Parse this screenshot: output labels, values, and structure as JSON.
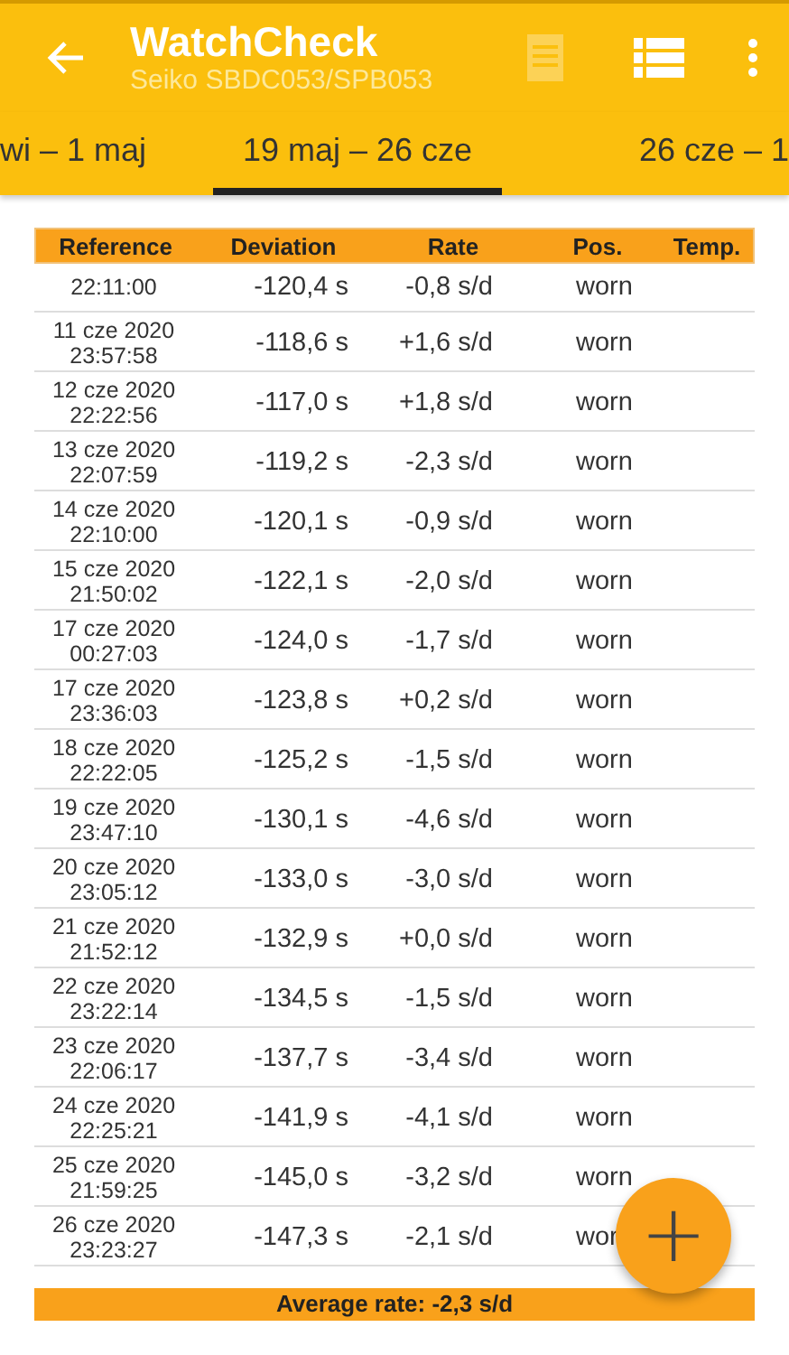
{
  "app_bar": {
    "title": "WatchCheck",
    "subtitle": "Seiko SBDC053/SPB053",
    "actions": [
      {
        "kind": "document",
        "disabled": true
      },
      {
        "kind": "list",
        "disabled": false
      },
      {
        "kind": "more",
        "disabled": false
      }
    ]
  },
  "tabs": [
    {
      "label": "wi – 1 maj",
      "selected": false
    },
    {
      "label": "19 maj – 26 cze",
      "selected": true
    },
    {
      "label": "26 cze – 1",
      "selected": false
    }
  ],
  "table": {
    "columns": [
      "Reference",
      "Deviation",
      "Rate",
      "Pos.",
      "Temp."
    ],
    "rows": [
      {
        "time": "22:11:00",
        "deviation": "-120,4 s",
        "rate": "-0,8 s/d",
        "position": "worn"
      },
      {
        "date": "11 cze 2020",
        "time": "23:57:58",
        "deviation": "-118,6 s",
        "rate": "+1,6 s/d",
        "position": "worn"
      },
      {
        "date": "12 cze 2020",
        "time": "22:22:56",
        "deviation": "-117,0 s",
        "rate": "+1,8 s/d",
        "position": "worn"
      },
      {
        "date": "13 cze 2020",
        "time": "22:07:59",
        "deviation": "-119,2 s",
        "rate": "-2,3 s/d",
        "position": "worn"
      },
      {
        "date": "14 cze 2020",
        "time": "22:10:00",
        "deviation": "-120,1 s",
        "rate": "-0,9 s/d",
        "position": "worn"
      },
      {
        "date": "15 cze 2020",
        "time": "21:50:02",
        "deviation": "-122,1 s",
        "rate": "-2,0 s/d",
        "position": "worn"
      },
      {
        "date": "17 cze 2020",
        "time": "00:27:03",
        "deviation": "-124,0 s",
        "rate": "-1,7 s/d",
        "position": "worn"
      },
      {
        "date": "17 cze 2020",
        "time": "23:36:03",
        "deviation": "-123,8 s",
        "rate": "+0,2 s/d",
        "position": "worn"
      },
      {
        "date": "18 cze 2020",
        "time": "22:22:05",
        "deviation": "-125,2 s",
        "rate": "-1,5 s/d",
        "position": "worn"
      },
      {
        "date": "19 cze 2020",
        "time": "23:47:10",
        "deviation": "-130,1 s",
        "rate": "-4,6 s/d",
        "position": "worn"
      },
      {
        "date": "20 cze 2020",
        "time": "23:05:12",
        "deviation": "-133,0 s",
        "rate": "-3,0 s/d",
        "position": "worn"
      },
      {
        "date": "21 cze 2020",
        "time": "21:52:12",
        "deviation": "-132,9 s",
        "rate": "+0,0 s/d",
        "position": "worn"
      },
      {
        "date": "22 cze 2020",
        "time": "23:22:14",
        "deviation": "-134,5 s",
        "rate": "-1,5 s/d",
        "position": "worn"
      },
      {
        "date": "23 cze 2020",
        "time": "22:06:17",
        "deviation": "-137,7 s",
        "rate": "-3,4 s/d",
        "position": "worn"
      },
      {
        "date": "24 cze 2020",
        "time": "22:25:21",
        "deviation": "-141,9 s",
        "rate": "-4,1 s/d",
        "position": "worn"
      },
      {
        "date": "25 cze 2020",
        "time": "21:59:25",
        "deviation": "-145,0 s",
        "rate": "-3,2 s/d",
        "position": "worn"
      },
      {
        "date": "26 cze 2020",
        "time": "23:23:27",
        "deviation": "-147,3 s",
        "rate": "-2,1 s/d",
        "position": "wor"
      }
    ],
    "footer": "Average rate: -2,3 s/d"
  },
  "fab": {
    "label": "+"
  }
}
